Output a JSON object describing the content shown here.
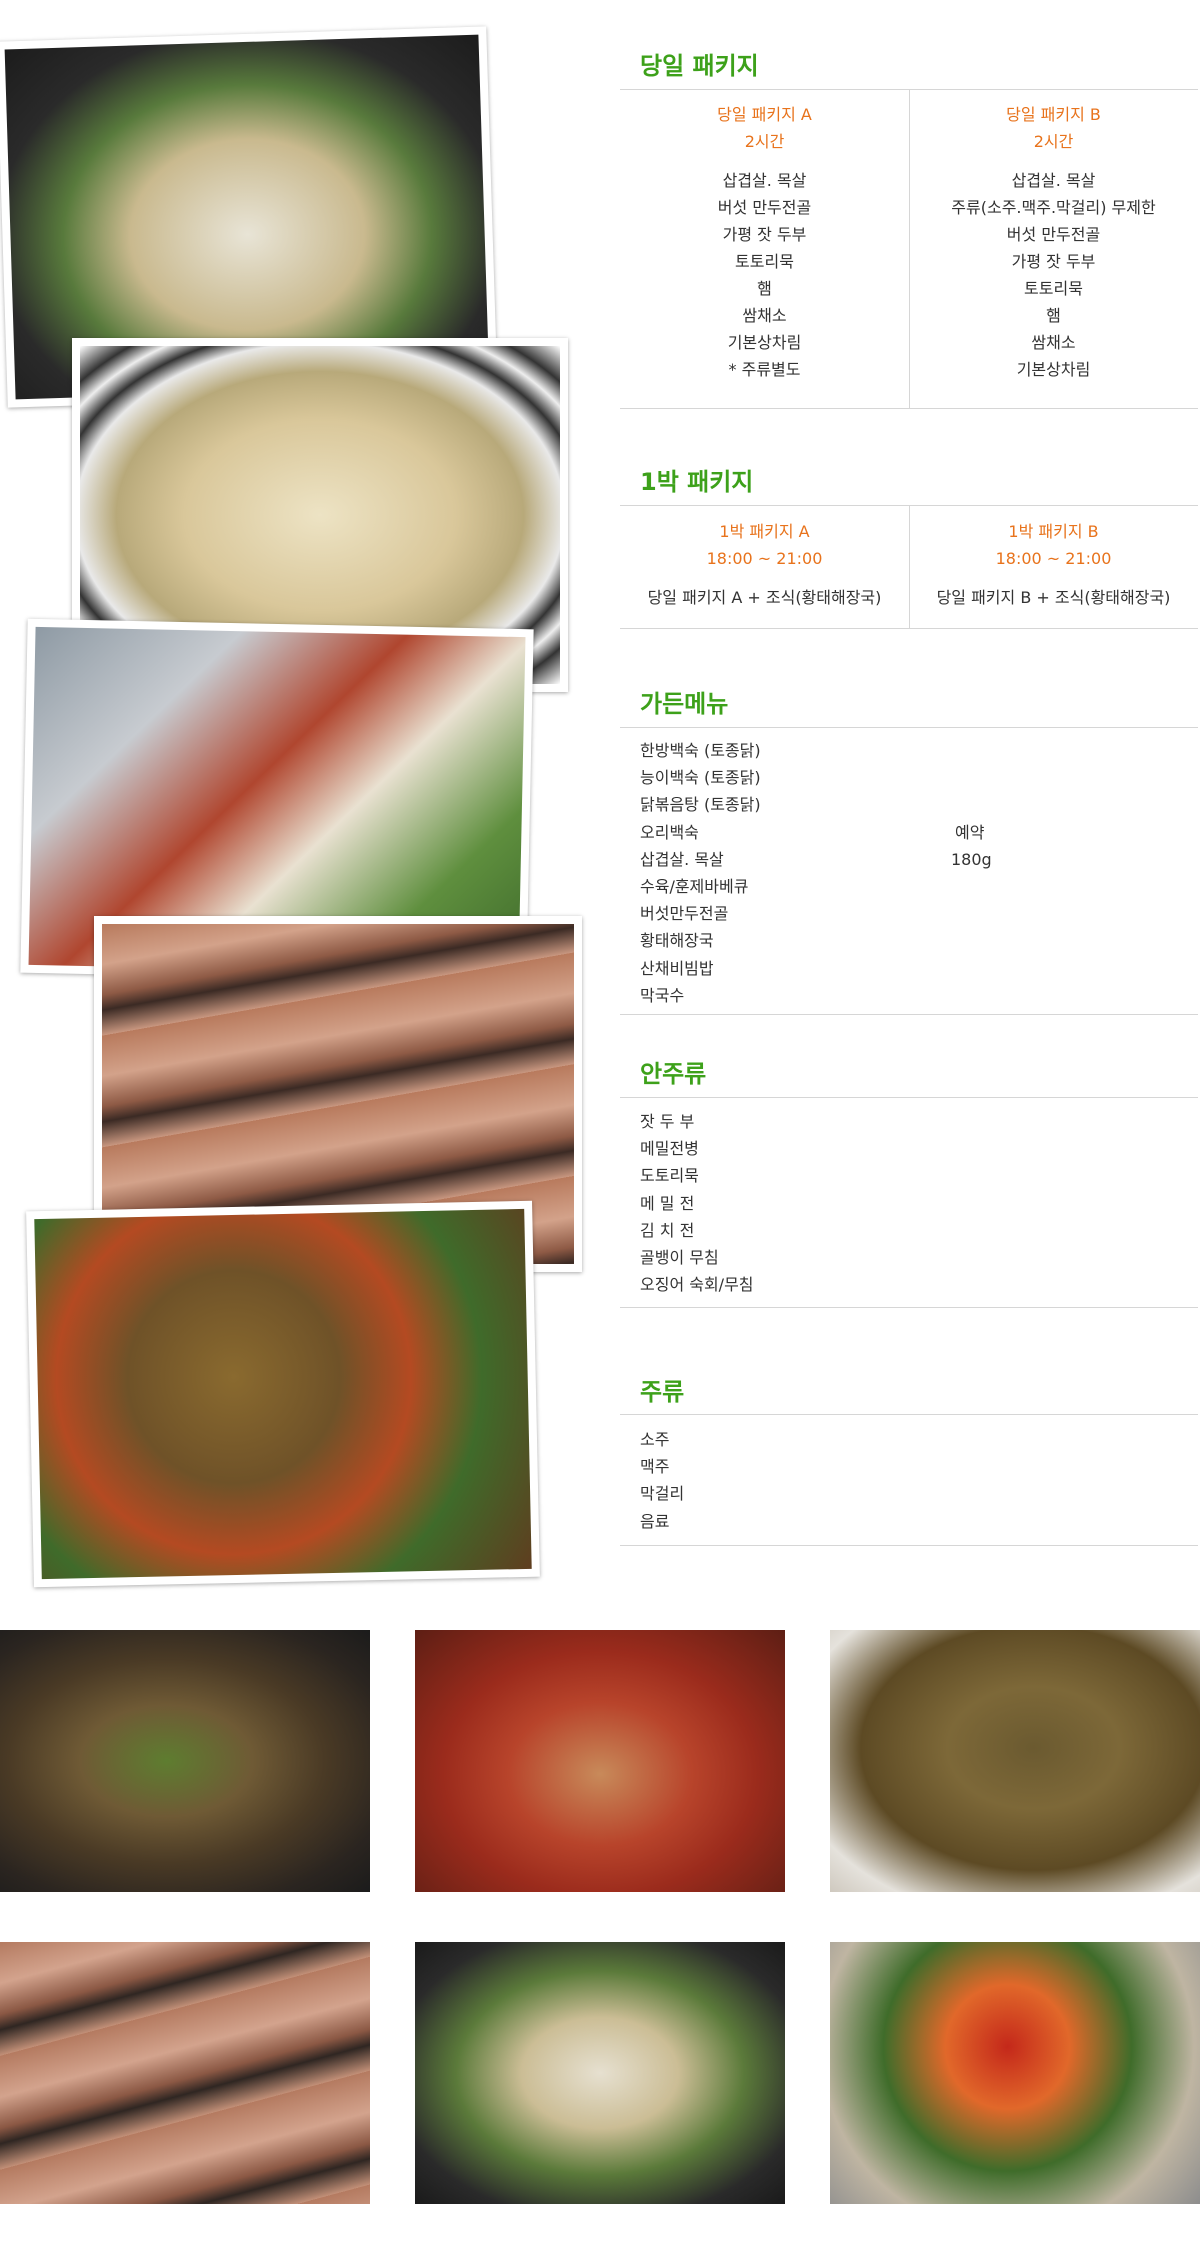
{
  "colors": {
    "section_title": "#3da11a",
    "package_name": "#e8731c",
    "divider": "#d6d6d6"
  },
  "sections": {
    "day_package": {
      "title": "당일 패키지",
      "a": {
        "name": "당일 패키지 A",
        "duration": "2시간",
        "items": [
          "삽겹살. 목살",
          "버섯 만두전골",
          "가평 잣 두부",
          "토토리묵",
          "햄",
          "쌈채소",
          "기본상차림",
          "* 주류별도"
        ]
      },
      "b": {
        "name": "당일 패키지 B",
        "duration": "2시간",
        "items": [
          "삽겹살. 목살",
          "주류(소주.맥주.막걸리) 무제한",
          "버섯 만두전골",
          "가평 잣 두부",
          "토토리묵",
          "햄",
          "쌈채소",
          "기본상차림"
        ]
      }
    },
    "overnight_package": {
      "title": "1박 패키지",
      "a": {
        "name": "1박 패키지 A",
        "time": "18:00 ~ 21:00",
        "desc": "당일 패키지 A + 조식(황태해장국)"
      },
      "b": {
        "name": "1박 패키지 B",
        "time": "18:00 ~ 21:00",
        "desc": "당일 패키지 B + 조식(황태해장국)"
      }
    },
    "garden_menu": {
      "title": "가든메뉴",
      "items": [
        "한방백숙 (토종닭)",
        "능이백숙 (토종닭)",
        "닭볶음탕 (토종닭)",
        "오리백숙",
        "삽겹살. 목살",
        "수육/훈제바베큐",
        "버섯만두전골",
        "황태해장국",
        "산채비빔밥",
        "막국수"
      ],
      "note_reserve": "예약",
      "note_weight": "180g"
    },
    "side_dishes": {
      "title": "안주류",
      "items": [
        "잣 두 부",
        "메밀전병",
        "도토리묵",
        "메 밀 전",
        "김 치 전",
        "골뱅이 무침",
        "오징어 숙회/무침"
      ]
    },
    "drinks": {
      "title": "주류",
      "items": [
        "소주",
        "맥주",
        "막걸리",
        "음료"
      ]
    }
  }
}
